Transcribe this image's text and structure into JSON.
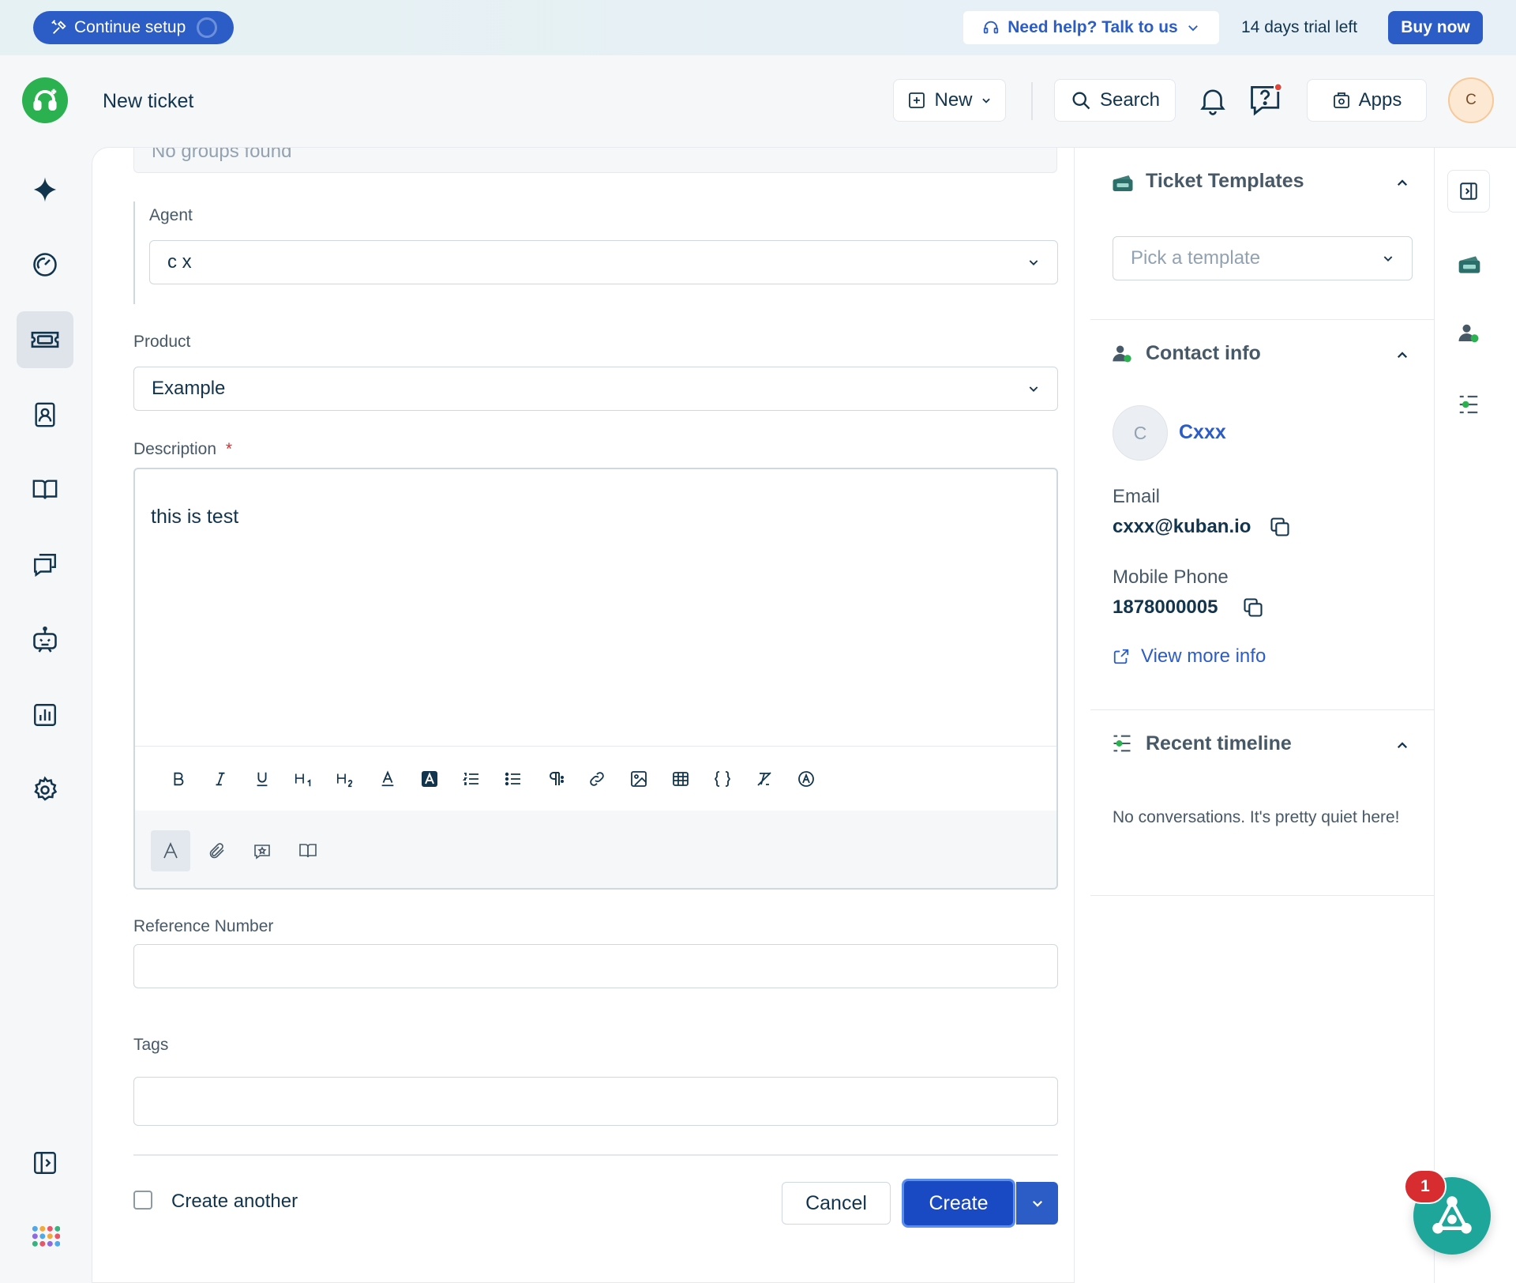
{
  "banner": {
    "continue_setup": "Continue setup",
    "help": "Need help? Talk to us",
    "trial": "14 days trial left",
    "buy_now": "Buy now"
  },
  "header": {
    "title": "New ticket",
    "new_label": "New",
    "search_label": "Search",
    "apps_label": "Apps",
    "avatar_initial": "C"
  },
  "nav": {
    "items": [
      "sparkle",
      "dashboard",
      "tickets",
      "contacts",
      "knowledge-base",
      "conversations",
      "bot",
      "reports",
      "settings"
    ],
    "active": "tickets"
  },
  "form": {
    "groups_empty": "No groups found",
    "agent_label": "Agent",
    "agent_value": "c x",
    "product_label": "Product",
    "product_value": "Example",
    "description_label": "Description",
    "required_mark": "*",
    "description_value": "this is test",
    "reference_label": "Reference Number",
    "reference_value": "",
    "tags_label": "Tags",
    "tags_value": "",
    "create_another": "Create another",
    "cancel": "Cancel",
    "create": "Create"
  },
  "sidebar": {
    "templates_title": "Ticket Templates",
    "template_placeholder": "Pick a template",
    "contact_title": "Contact info",
    "contact_initial": "C",
    "contact_name": "Cxxx",
    "email_label": "Email",
    "email_value": "cxxx@kuban.io",
    "phone_label": "Mobile Phone",
    "phone_value": "1878000005",
    "view_more": "View more info",
    "timeline_title": "Recent timeline",
    "timeline_empty": "No conversations. It's pretty quiet here!"
  },
  "notifications": {
    "fab_badge": "1"
  },
  "colors": {
    "primary": "#2c5cc5",
    "create_button": "#1a49c4",
    "logo_green": "#2bb150",
    "fab": "#1fa69a",
    "badge_red": "#d72d30",
    "required": "#d72d30"
  }
}
